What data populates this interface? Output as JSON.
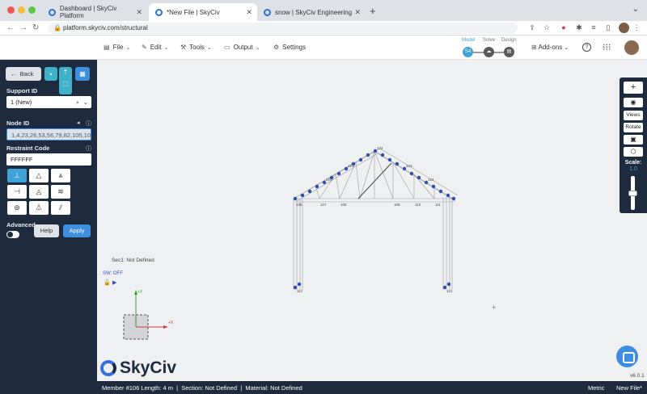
{
  "browser": {
    "tabs": [
      {
        "title": "Dashboard | SkyCiv Platform"
      },
      {
        "title": "*New File | SkyCiv"
      },
      {
        "title": "snow | SkyCiv Engineering"
      }
    ],
    "url": "platform.skyciv.com/structural"
  },
  "appbar": {
    "menus": [
      {
        "label": "File",
        "icon": "file-icon"
      },
      {
        "label": "Edit",
        "icon": "edit-icon"
      },
      {
        "label": "Tools",
        "icon": "wrench-icon"
      },
      {
        "label": "Output",
        "icon": "monitor-icon"
      },
      {
        "label": "Settings",
        "icon": "gear-icon"
      }
    ],
    "steps": [
      {
        "label": "Model"
      },
      {
        "label": "Solve"
      },
      {
        "label": "Design"
      }
    ],
    "addons_label": "Add-ons"
  },
  "sidebar": {
    "back_label": "Back",
    "support_id_label": "Support ID",
    "support_id_value": "1 (New)",
    "node_id_label": "Node ID",
    "node_id_value": "1,4,23,26,53,56,79,82,105,108",
    "restraint_code_label": "Restraint Code",
    "restraint_code_value": "FFFFFF",
    "advanced_label": "Advanced",
    "help_label": "Help",
    "apply_label": "Apply"
  },
  "canvas": {
    "sec_label": "Sec1: Not Defined",
    "sw_label": "SW: OFF",
    "axis_y": "+Y",
    "axis_x": "+X",
    "logo_text": "SkyCiv",
    "version": "v6.0.1",
    "node_labels": [
      "106",
      "107",
      "108",
      "109",
      "110",
      "111",
      "112",
      "113",
      "120",
      "121",
      "122",
      "123",
      "124",
      "125",
      "126",
      "127",
      "128",
      "129",
      "130"
    ]
  },
  "right_toolbar": {
    "views_label": "Views",
    "rotate_label": "Rotate",
    "scale_label": "Scale:",
    "scale_value": "1.0"
  },
  "statusbar": {
    "member_info": "Member #106 Length: 4 m  |  Section: Not Defined  |  Material: Not Defined",
    "units": "Metric",
    "file": "New File*"
  },
  "colors": {
    "sidebar_bg": "#1e2a3d",
    "accent": "#3f8fe0",
    "teal": "#3fb1c9",
    "support_node": "#2d4fa8"
  }
}
